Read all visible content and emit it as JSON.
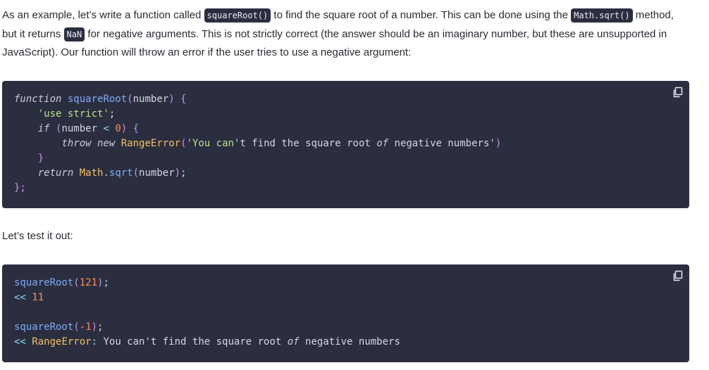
{
  "intro": {
    "t1": "As an example, let’s write a function called ",
    "code1": "squareRoot()",
    "t2": " to find the square root of a number. This can be done using the ",
    "code2": "Math.sqrt()",
    "t3": " method, but it returns ",
    "code3": "NaN",
    "t4": " for negative arguments. This is not strictly correct (the answer should be an imaginary number, but these are unsupported in JavaScript). Our function will throw an error if the user tries to use a negative argument:"
  },
  "test_text": "Let’s test it out:",
  "block1": {
    "l1": {
      "kw": "function",
      "fn": "squareRoot",
      "p1": "(",
      "arg": "number",
      "p2": ")",
      "brace": " {"
    },
    "l2": {
      "str": "'use strict'",
      "semi": ";"
    },
    "l3": {
      "kw": "if",
      "p1": "(",
      "var": "number",
      "op": "<",
      "num": "0",
      "p2": ")",
      "brace": " {"
    },
    "l4": {
      "kw1": "throw",
      "kw2": "new",
      "cls": "RangeError",
      "p1": "(",
      "str1": "'You can",
      "plain1": "'t find the square root ",
      "kw3": "of",
      "plain2": " negative numbers'",
      "p2": ")"
    },
    "l5": {
      "brace": "}"
    },
    "l6": {
      "kw": "return",
      "cls": "Math",
      "dot": ".",
      "fn": "sqrt",
      "p1": "(",
      "arg": "number",
      "p2": ")",
      "semi": ";"
    },
    "l7": {
      "end": "};"
    }
  },
  "block2": {
    "l1": {
      "fn": "squareRoot",
      "p1": "(",
      "num": "121",
      "p2": ")",
      "semi": ";"
    },
    "l2": {
      "prompt": "<<",
      "num": "11"
    },
    "l4": {
      "fn": "squareRoot",
      "p1": "(",
      "num": "-1",
      "p2": ")",
      "semi": ";"
    },
    "l5": {
      "prompt": "<<",
      "cls": "RangeError",
      "colon": ":",
      "plain1": " You can't find the square root ",
      "kw": "of",
      "plain2": " negative numbers"
    }
  },
  "icons": {
    "copy": "copy-icon"
  },
  "colors": {
    "code_bg": "#2b2e3f",
    "fn": "#7eaaf7",
    "class": "#f2c168",
    "string": "#b9e28a",
    "number": "#ff8c5a"
  }
}
